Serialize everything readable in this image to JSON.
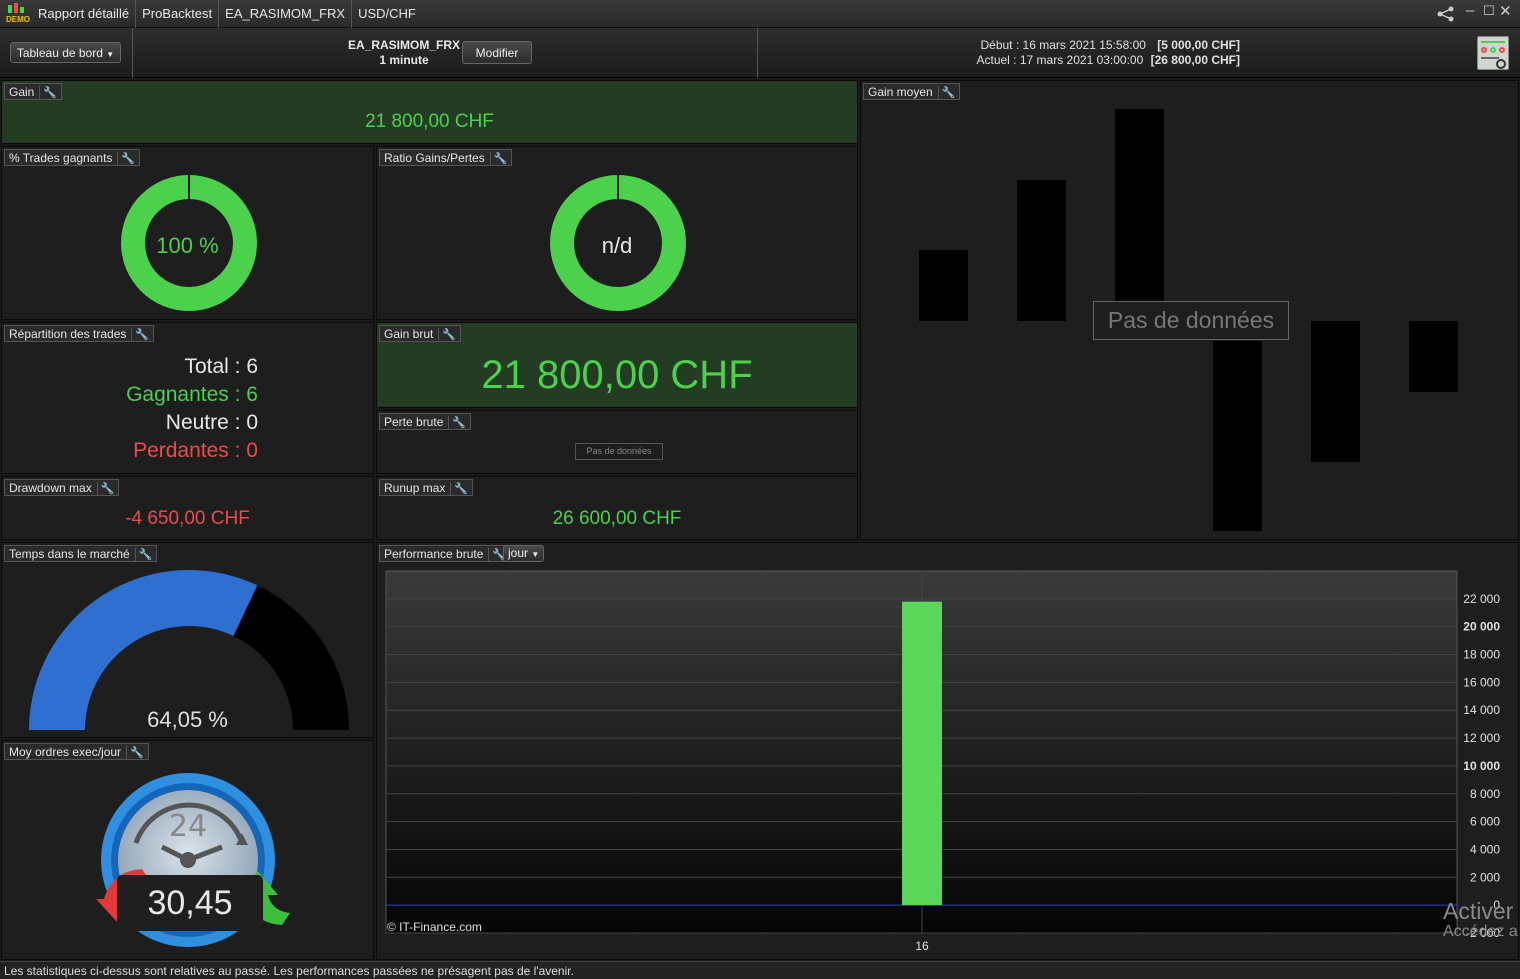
{
  "titlebar": {
    "badge": "DEMO",
    "crumbs": [
      "Rapport détaillé",
      "ProBacktest",
      "EA_RASIMOM_FRX",
      "USD/CHF"
    ]
  },
  "header": {
    "dashboard_label": "Tableau de bord",
    "strategy_name": "EA_RASIMOM_FRX",
    "timeframe": "1 minute",
    "modify_label": "Modifier",
    "start_label": "Début :",
    "start_date": "16 mars 2021 15:58:00",
    "start_capital": "[5 000,00 CHF]",
    "current_label": "Actuel :",
    "current_date": "17 mars 2021 03:00:00",
    "current_capital": "[26 800,00 CHF]"
  },
  "panels": {
    "gain": {
      "title": "Gain",
      "value": "21 800,00 CHF"
    },
    "win_pct": {
      "title": "% Trades gagnants",
      "value": "100 %",
      "fraction": 1.0
    },
    "ratio": {
      "title": "Ratio Gains/Pertes",
      "value": "n/d"
    },
    "distribution": {
      "title": "Répartition des trades",
      "total_label": "Total : 6",
      "winners_label": "Gagnantes : 6",
      "neutral_label": "Neutre : 0",
      "losers_label": "Perdantes : 0"
    },
    "gross_gain": {
      "title": "Gain brut",
      "value": "21 800,00 CHF"
    },
    "gross_loss": {
      "title": "Perte brute",
      "no_data": "Pas de données"
    },
    "drawdown": {
      "title": "Drawdown max",
      "value": "-4 650,00 CHF"
    },
    "runup": {
      "title": "Runup max",
      "value": "26 600,00 CHF"
    },
    "avg_gain": {
      "title": "Gain moyen",
      "no_data": "Pas de données"
    },
    "market_time": {
      "title": "Temps dans le marché",
      "value": "64,05 %",
      "fraction": 0.6405
    },
    "orders": {
      "title": "Moy ordres exec/jour",
      "clock_label": "24",
      "value": "30,45"
    },
    "performance": {
      "title": "Performance brute",
      "period": "jour",
      "copyright": "© IT-Finance.com"
    }
  },
  "chart_data": {
    "type": "bar",
    "categories": [
      "16"
    ],
    "values": [
      21800
    ],
    "yticks": [
      "22 000",
      "20 000",
      "18 000",
      "16 000",
      "14 000",
      "12 000",
      "10 000",
      "8 000",
      "6 000",
      "4 000",
      "2 000",
      "0",
      "-2 000"
    ],
    "ytick_values": [
      22000,
      20000,
      18000,
      16000,
      14000,
      12000,
      10000,
      8000,
      6000,
      4000,
      2000,
      0,
      -2000
    ],
    "ylim": [
      -2000,
      24000
    ],
    "colors": {
      "bar": "#5ad65a",
      "zero_line": "#3a3ad0"
    }
  },
  "watermark": {
    "line1": "Activer",
    "line2": "Accédez a"
  },
  "footer": {
    "text": "Les statistiques ci-dessus sont relatives au passé. Les performances passées ne présagent pas de l'avenir."
  },
  "colors": {
    "green": "#4cd14c",
    "red": "#ee4a4a",
    "blue": "#2f6fd0",
    "panel_green": "#243b24"
  }
}
